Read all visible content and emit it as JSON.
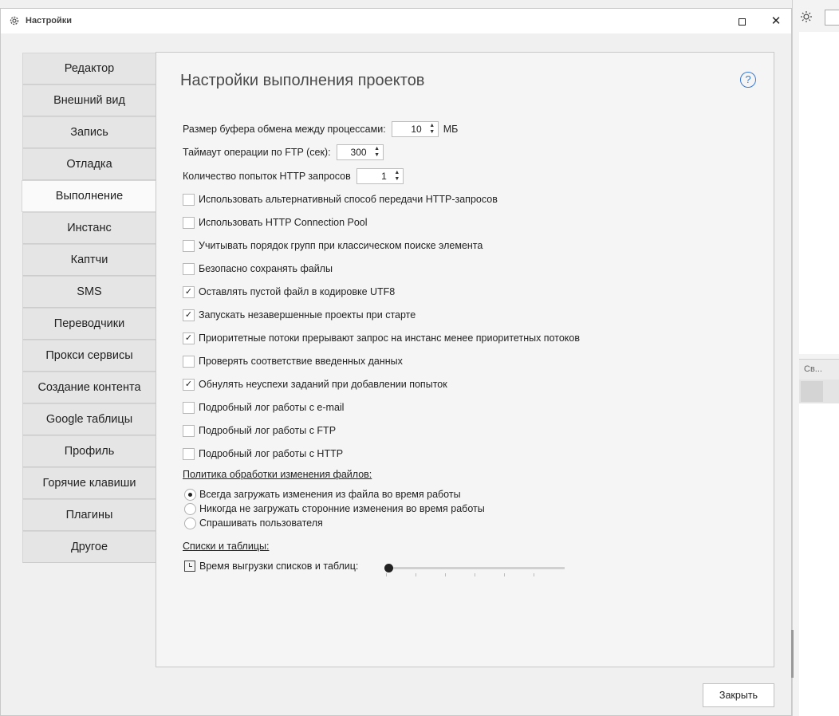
{
  "window": {
    "title": "Настройки",
    "close_glyph": "✕"
  },
  "nav": {
    "items": [
      "Редактор",
      "Внешний вид",
      "Запись",
      "Отладка",
      "Выполнение",
      "Инстанс",
      "Каптчи",
      "SMS",
      "Переводчики",
      "Прокси сервисы",
      "Создание контента",
      "Google таблицы",
      "Профиль",
      "Горячие клавиши",
      "Плагины",
      "Другое"
    ],
    "active": "Выполнение"
  },
  "page": {
    "heading": "Настройки выполнения проектов",
    "help_glyph": "?"
  },
  "fields": {
    "buffer": {
      "label": "Размер буфера обмена между процессами:",
      "value": "10",
      "unit": "МБ"
    },
    "ftp_timeout": {
      "label": "Таймаут операции по FTP (сек):",
      "value": "300"
    },
    "http_attempts": {
      "label": "Количество попыток HTTP запросов",
      "value": "1"
    }
  },
  "checkboxes": [
    {
      "label": "Использовать альтернативный способ передачи HTTP-запросов",
      "checked": false
    },
    {
      "label": "Использовать HTTP Connection Pool",
      "checked": false
    },
    {
      "label": "Учитывать порядок групп при классическом поиске элемента",
      "checked": false
    },
    {
      "label": "Безопасно сохранять файлы",
      "checked": false
    },
    {
      "label": "Оставлять пустой файл в кодировке UTF8",
      "checked": true
    },
    {
      "label": "Запускать незавершенные проекты при старте",
      "checked": true
    },
    {
      "label": "Приоритетные потоки прерывают запрос на инстанс менее приоритетных потоков",
      "checked": true
    },
    {
      "label": "Проверять соответствие введенных данных",
      "checked": false
    },
    {
      "label": "Обнулять неуспехи заданий при добавлении попыток",
      "checked": true
    },
    {
      "label": "Подробный лог работы с e-mail",
      "checked": false
    },
    {
      "label": "Подробный лог работы с FTP",
      "checked": false
    },
    {
      "label": "Подробный лог работы с HTTP",
      "checked": false
    }
  ],
  "file_policy": {
    "title": "Политика обработки изменения файлов:",
    "options": [
      {
        "label": "Всегда загружать изменения из файла во время работы",
        "selected": true
      },
      {
        "label": "Никогда не загружать сторонние изменения во время работы",
        "selected": false
      },
      {
        "label": "Спрашивать пользователя",
        "selected": false
      }
    ]
  },
  "lists": {
    "title": "Списки и таблицы:",
    "slider_label": "Время выгрузки списков и таблиц:",
    "slider_position": 0
  },
  "footer": {
    "close_label": "Закрыть"
  },
  "background": {
    "panel_label": "Св..."
  }
}
